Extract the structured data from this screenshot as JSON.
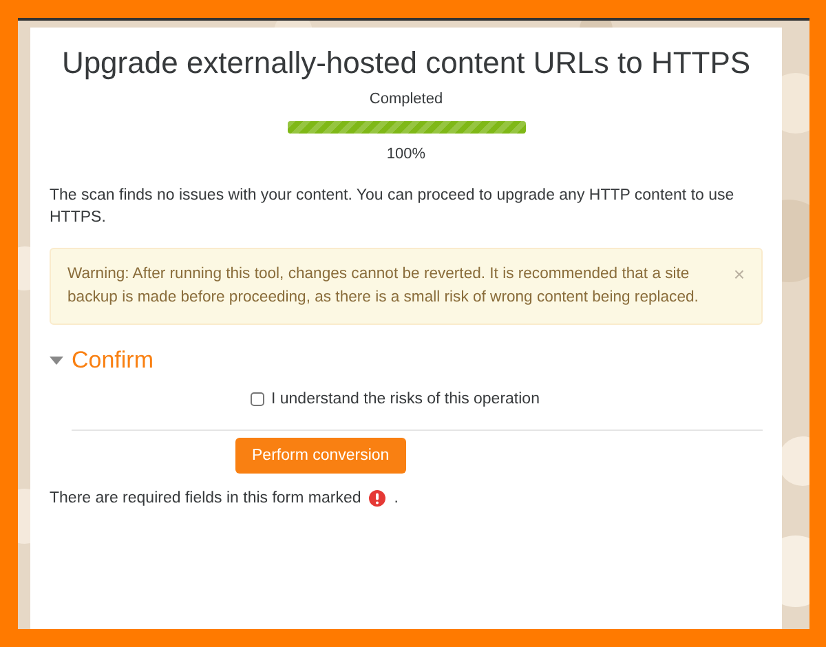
{
  "title": "Upgrade externally-hosted content URLs to HTTPS",
  "status": "Completed",
  "progress": {
    "level": 1,
    "reading": "100%"
  },
  "message": "The scan finds no issues with your content. You can proceed to upgrade any HTTP content to use HTTPS.",
  "alert": {
    "text": "Warning: After running this tool, changes cannot be reverted. It is recommended that a site backup is made before proceeding, as there is a small risk of wrong content being replaced.",
    "close": "×"
  },
  "section": {
    "title": "Confirm",
    "expanded": true,
    "checkbox": {
      "label": "I understand the risks of this operation",
      "checked": false
    },
    "button": "Perform conversion"
  },
  "required_note": {
    "before": "There are required fields in this form marked",
    "after": "."
  }
}
